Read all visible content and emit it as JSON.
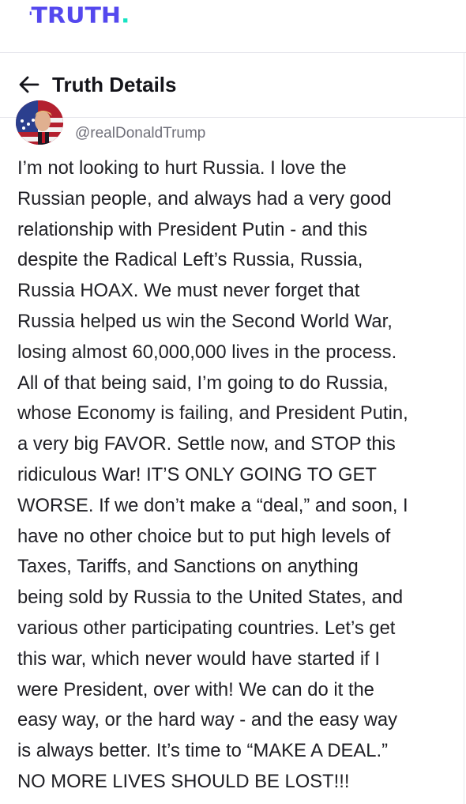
{
  "brand": {
    "logo_text": "TRUTH",
    "logo_dot": ".",
    "primary_color": "#5448ee",
    "accent_color": "#17e3c2"
  },
  "header": {
    "back_icon": "arrow-left-icon",
    "title": "Truth Details"
  },
  "post": {
    "avatar_icon": "avatar-image",
    "handle": "@realDonaldTrump",
    "lines": [
      "I’m not looking to hurt Russia. I love the",
      "Russian people, and always had a very good",
      "relationship with President Putin - and this",
      "despite the Radical Left’s Russia, Russia,",
      "Russia HOAX. We must never forget that",
      "Russia helped us win the Second World War,",
      "losing almost 60,000,000 lives in the process.",
      "All of that being said, I’m going to do Russia,",
      "whose Economy is failing, and President Putin,",
      "a very big FAVOR. Settle now, and STOP this",
      "ridiculous War! IT’S ONLY GOING TO GET",
      "WORSE. If we don’t make a “deal,” and soon, I",
      "have no other choice but to put high levels of",
      "Taxes, Tariffs, and Sanctions on anything",
      "being sold by Russia to the United States, and",
      "various other participating countries. Let’s get",
      "this war, which never would have started if I",
      "were President, over with! We can do it the",
      "easy way, or the hard way - and the easy way",
      "is always better. It’s time to “MAKE A DEAL.”",
      "NO MORE LIVES SHOULD BE LOST!!!"
    ]
  }
}
